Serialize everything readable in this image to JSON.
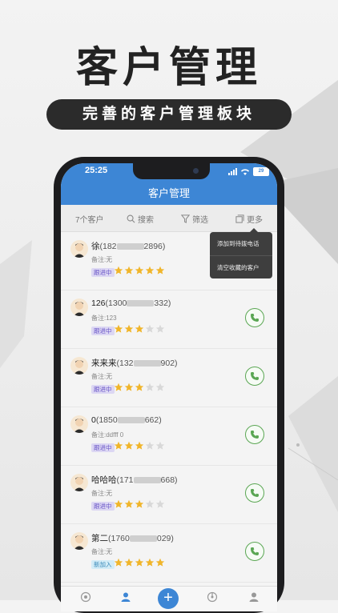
{
  "hero": {
    "title": "客户管理",
    "subtitle": "完善的客户管理板块"
  },
  "status": {
    "time": "25:25",
    "battery": "29"
  },
  "appbar": {
    "title": "客户管理"
  },
  "toolbar": {
    "count": "7个客户",
    "search": "搜索",
    "filter": "筛选",
    "more": "更多"
  },
  "dropdown": {
    "items": [
      "添加到待拨电话",
      "清空收藏的客户"
    ]
  },
  "customers": [
    {
      "name": "徐",
      "phone_prefix": "(182",
      "phone_suffix": "2896)",
      "note": "备注:无",
      "status": "跟进中",
      "stars": 5,
      "call": false
    },
    {
      "name": "126",
      "phone_prefix": "(1300",
      "phone_suffix": "332)",
      "note": "备注:123",
      "status": "跟进中",
      "stars": 3,
      "call": true
    },
    {
      "name": "来来来",
      "phone_prefix": "(132",
      "phone_suffix": "902)",
      "note": "备注:无",
      "status": "跟进中",
      "stars": 3,
      "call": true
    },
    {
      "name": "0",
      "phone_prefix": "(1850",
      "phone_suffix": "662)",
      "note": "备注:ddfff 0",
      "status": "跟进中",
      "stars": 3,
      "call": true
    },
    {
      "name": "哈哈哈",
      "phone_prefix": "(171",
      "phone_suffix": "668)",
      "note": "备注:无",
      "status": "跟进中",
      "stars": 3,
      "call": true
    },
    {
      "name": "第二",
      "phone_prefix": "(1760",
      "phone_suffix": "029)",
      "note": "备注:无",
      "status": "新加入",
      "stars": 5,
      "call": true
    }
  ],
  "tabbar": {
    "items": [
      "home-icon",
      "contacts-icon",
      "add-icon",
      "stats-icon",
      "profile-icon"
    ]
  },
  "colors": {
    "primary": "#3d86d5",
    "star_on": "#f0b52a",
    "star_off": "#d8d8d8",
    "call_green": "#5aa653"
  }
}
